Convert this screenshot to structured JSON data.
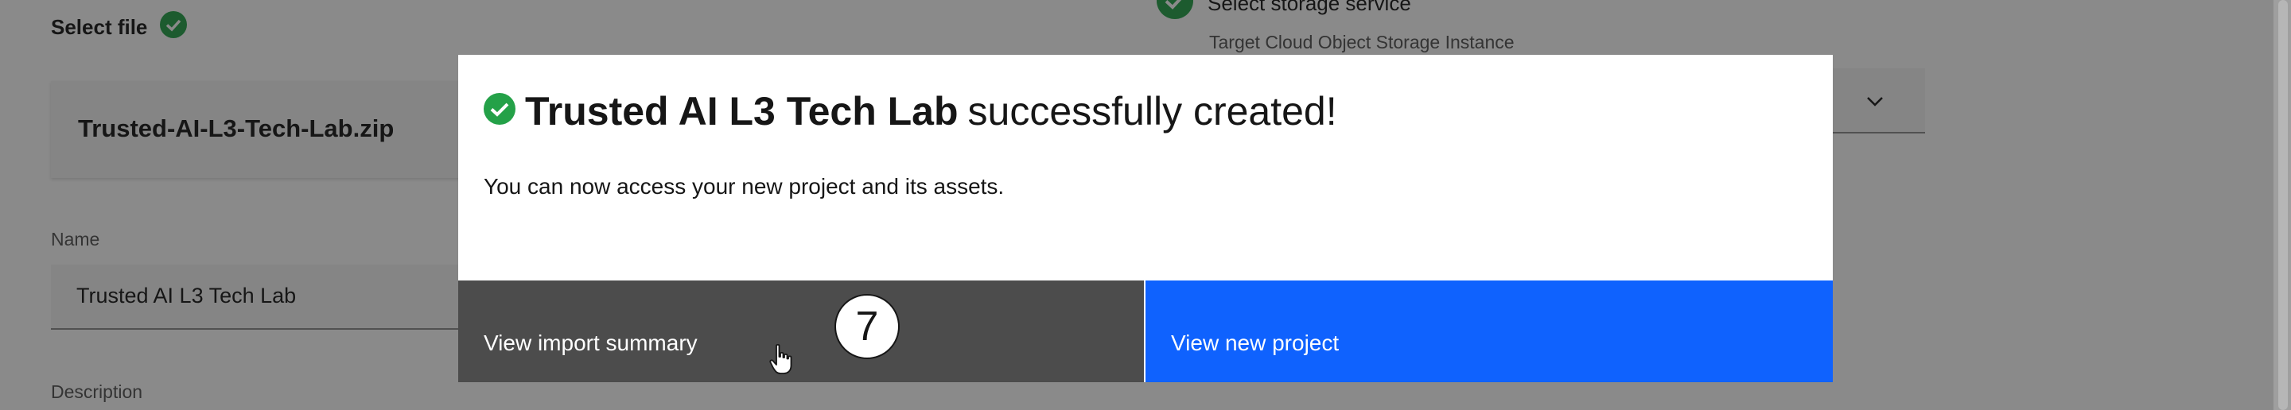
{
  "form": {
    "select_file_label": "Select file",
    "file_name": "Trusted-AI-L3-Tech-Lab.zip",
    "name_label": "Name",
    "name_value": "Trusted AI L3 Tech Lab",
    "description_label": "Description",
    "storage_step_label": "Select storage service",
    "storage_sub_label": "Target Cloud Object Storage Instance"
  },
  "modal": {
    "title_bold": "Trusted AI L3 Tech Lab",
    "title_rest": "successfully created!",
    "body": "You can now access your new project and its assets.",
    "secondary_button": "View import summary",
    "primary_button": "View new project"
  },
  "annotation": {
    "step_number": "7"
  },
  "colors": {
    "primary": "#0f62fe",
    "secondary": "#4c4c4c",
    "success": "#24a148"
  },
  "icons": {
    "success": "checkmark-filled-icon",
    "chevron": "chevron-down-icon",
    "cursor": "hand-pointer-icon"
  }
}
